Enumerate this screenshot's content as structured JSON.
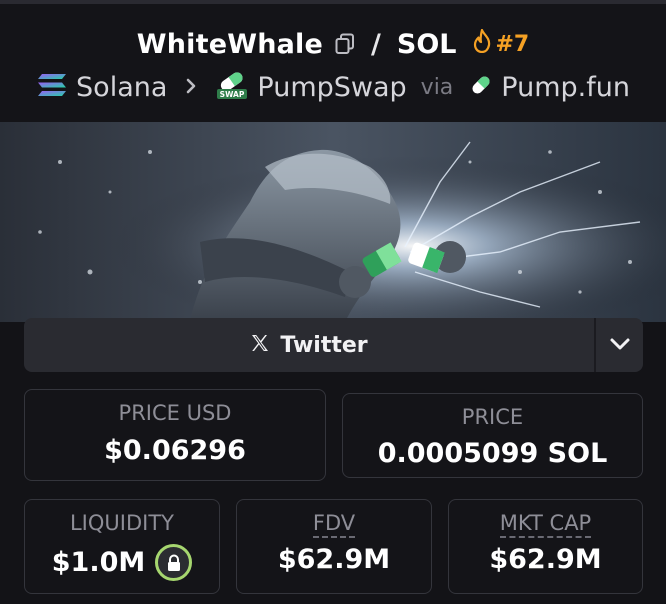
{
  "header": {
    "token_name": "WhiteWhale",
    "separator": "/",
    "quote_token": "SOL",
    "rank": "#7",
    "chain": "Solana",
    "dex": "PumpSwap",
    "dex_icon_text": "SWAP",
    "via": "via",
    "launchpad": "Pump.fun"
  },
  "social": {
    "label": "Twitter"
  },
  "stats": {
    "price_usd": {
      "label": "PRICE USD",
      "value": "$0.06296"
    },
    "price": {
      "label": "PRICE",
      "value": "0.0005099 SOL"
    },
    "liquidity": {
      "label": "LIQUIDITY",
      "value": "$1.0M"
    },
    "fdv": {
      "label": "FDV",
      "value": "$62.9M"
    },
    "mkt_cap": {
      "label": "MKT CAP",
      "value": "$62.9M"
    }
  },
  "colors": {
    "background": "#131317",
    "accent_flame": "#f5a124",
    "lock_ring": "#a6d66f",
    "card_border": "#34353c"
  },
  "icons": [
    "copy-icon",
    "flame-icon",
    "solana-icon",
    "pumpswap-icon",
    "pill-icon",
    "x-logo-icon",
    "chevron-down-icon",
    "lock-icon"
  ]
}
